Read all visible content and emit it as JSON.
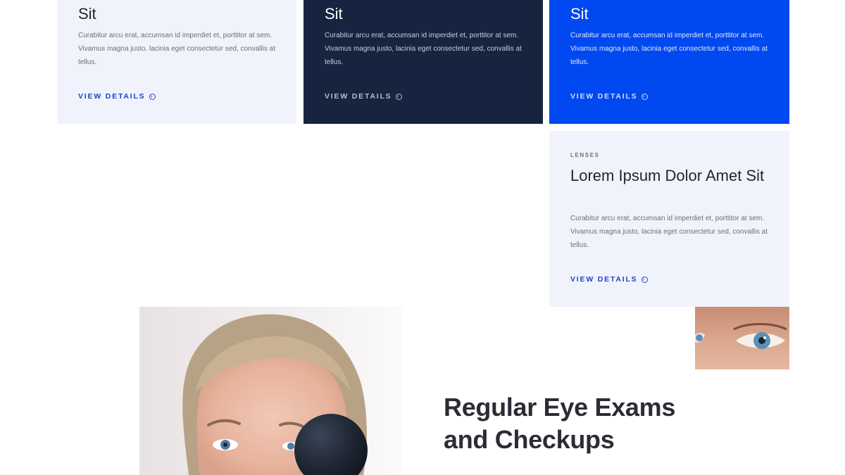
{
  "cards": [
    {
      "title": "Sit",
      "description": "Curabitur arcu erat, accumsan id imperdiet et, porttitor at sem. Vivamus magna justo, lacinia eget consectetur sed, convallis at tellus.",
      "link_label": "VIEW DETAILS",
      "link_icon": "chevron-right-circle-icon"
    },
    {
      "title": "Sit",
      "description": "Curabitur arcu erat, accumsan id imperdiet et, porttitor at sem. Vivamus magna justo, lacinia eget consectetur sed, convallis at tellus.",
      "link_label": "VIEW DETAILS",
      "link_icon": "chevron-right-circle-icon"
    },
    {
      "title": "Sit",
      "description": "Curabitur arcu erat, accumsan id imperdiet et, porttitor at sem. Vivamus magna justo, lacinia eget consectetur sed, convallis at tellus.",
      "link_label": "VIEW DETAILS",
      "link_icon": "chevron-right-circle-icon"
    },
    {
      "tag": "LENSES",
      "title": "Lorem Ipsum Dolor Amet Sit",
      "description": "Curabitur arcu erat, accumsan id imperdiet et, porttitor at sem. Vivamus magna justo, lacinia eget consectetur sed, convallis at tellus.",
      "link_label": "VIEW DETAILS",
      "link_icon": "chevron-right-circle-icon"
    }
  ],
  "section": {
    "heading": "Regular Eye Exams and Checkups"
  },
  "colors": {
    "card_light": "#f1f3fc",
    "card_dark": "#172440",
    "card_blue": "#0048f0",
    "link_blue": "#1a46c6",
    "heading": "#2a2d36"
  }
}
